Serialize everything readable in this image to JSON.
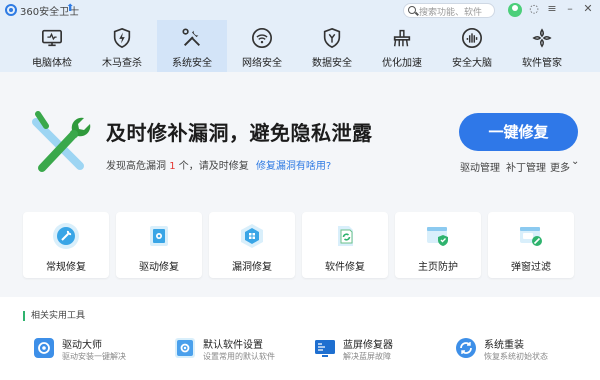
{
  "titlebar": {
    "app_title": "360安全卫士",
    "upgrade_icon": "arrow-up",
    "search_placeholder": "搜索功能、软件",
    "controls": {
      "skin": "◌",
      "menu": "≡",
      "minimize": "–",
      "close": "✕"
    }
  },
  "nav": {
    "active": "系统安全",
    "items": [
      {
        "label": "电脑体检",
        "icon": "monitor"
      },
      {
        "label": "木马查杀",
        "icon": "shield-bolt"
      },
      {
        "label": "系统安全",
        "icon": "tools"
      },
      {
        "label": "网络安全",
        "icon": "wifi"
      },
      {
        "label": "数据安全",
        "icon": "shield-y"
      },
      {
        "label": "优化加速",
        "icon": "broom"
      },
      {
        "label": "安全大脑",
        "icon": "brain-wave"
      },
      {
        "label": "软件管家",
        "icon": "flower-grid"
      }
    ]
  },
  "hero": {
    "headline": "及时修补漏洞，避免隐私泄露",
    "sub_prefix": "发现高危漏洞",
    "sub_count": "1",
    "sub_suffix": "个，请及时修复",
    "sub_link": "修复漏洞有啥用?",
    "primary_button": "一键修复",
    "links": [
      "驱动管理",
      "补丁管理",
      "更多"
    ],
    "more_caret": "⌄"
  },
  "tiles": [
    {
      "label": "常规修复",
      "icon": "wrench-circle"
    },
    {
      "label": "驱动修复",
      "icon": "driver-gear"
    },
    {
      "label": "漏洞修复",
      "icon": "windows-hex"
    },
    {
      "label": "软件修复",
      "icon": "software-refresh"
    },
    {
      "label": "主页防护",
      "icon": "homepage-shield"
    },
    {
      "label": "弹窗过滤",
      "icon": "popup-block"
    }
  ],
  "tools": {
    "title": "相关实用工具",
    "items": [
      {
        "title": "驱动大师",
        "desc": "驱动安装一键解决",
        "icon": "driver-master"
      },
      {
        "title": "默认软件设置",
        "desc": "设置常用的默认软件",
        "icon": "default-settings"
      },
      {
        "title": "蓝屏修复器",
        "desc": "解决蓝屏故障",
        "icon": "bluescreen-fixer"
      },
      {
        "title": "系统重装",
        "desc": "恢复系统初始状态",
        "icon": "system-reinstall"
      }
    ]
  },
  "colors": {
    "accent": "#2f78e8",
    "nav_bg": "#e4eef9",
    "alert": "#e53935",
    "tool_green": "#2fb36e"
  }
}
